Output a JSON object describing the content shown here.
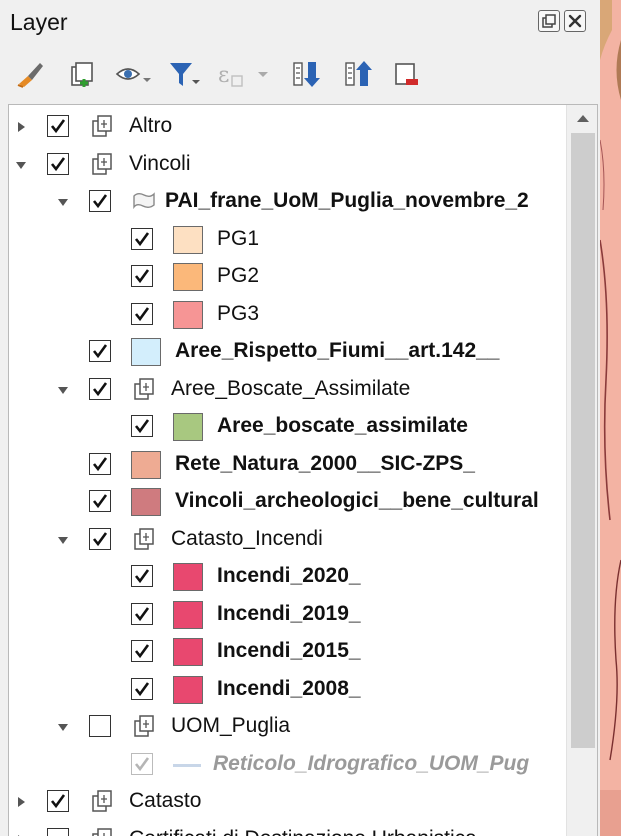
{
  "panel": {
    "title": "Layer"
  },
  "toolbar": {
    "icons": [
      "style-brush-icon",
      "add-group-icon",
      "visibility-eye-icon",
      "filter-icon",
      "expression-filter-icon",
      "expand-all-icon",
      "collapse-all-icon",
      "remove-layer-icon"
    ]
  },
  "tree": {
    "nodes": [
      {
        "label": "Altro",
        "level": 0,
        "expand": "collapsed",
        "checked": true,
        "icon": "group-icon",
        "bold": false
      },
      {
        "label": "Vincoli",
        "level": 0,
        "expand": "expanded",
        "checked": true,
        "icon": "group-icon",
        "bold": false
      },
      {
        "label": "PAI_frane_UoM_Puglia_novembre_2",
        "level": 1,
        "expand": "expanded",
        "checked": true,
        "icon": "polygon-layer-icon",
        "bold": true
      },
      {
        "label": "PG1",
        "level": 2,
        "expand": "none",
        "checked": true,
        "swatch": "#fde0c2",
        "bold": false
      },
      {
        "label": "PG2",
        "level": 2,
        "expand": "none",
        "checked": true,
        "swatch": "#fbb87a",
        "bold": false
      },
      {
        "label": "PG3",
        "level": 2,
        "expand": "none",
        "checked": true,
        "swatch": "#f69595",
        "bold": false
      },
      {
        "label": "Aree_Rispetto_Fiumi__art.142__",
        "level": 1,
        "expand": "none",
        "checked": true,
        "swatch": "#d3eefc",
        "bold": true
      },
      {
        "label": "Aree_Boscate_Assimilate",
        "level": 1,
        "expand": "expanded",
        "checked": true,
        "icon": "group-icon",
        "bold": false
      },
      {
        "label": "Aree_boscate_assimilate",
        "level": 2,
        "expand": "none",
        "checked": true,
        "swatch": "#a8c880",
        "bold": true
      },
      {
        "label": "Rete_Natura_2000__SIC-ZPS_",
        "level": 1,
        "expand": "none",
        "checked": true,
        "swatch": "#eeab93",
        "bold": true
      },
      {
        "label": "Vincoli_archeologici__bene_cultural",
        "level": 1,
        "expand": "none",
        "checked": true,
        "swatch": "#cf7b7f",
        "bold": true
      },
      {
        "label": "Catasto_Incendi",
        "level": 1,
        "expand": "expanded",
        "checked": true,
        "icon": "group-icon",
        "bold": false
      },
      {
        "label": "Incendi_2020_",
        "level": 2,
        "expand": "none",
        "checked": true,
        "swatch": "#e8486f",
        "bold": true
      },
      {
        "label": "Incendi_2019_",
        "level": 2,
        "expand": "none",
        "checked": true,
        "swatch": "#e8486f",
        "bold": true
      },
      {
        "label": "Incendi_2015_",
        "level": 2,
        "expand": "none",
        "checked": true,
        "swatch": "#e8486f",
        "bold": true
      },
      {
        "label": "Incendi_2008_",
        "level": 2,
        "expand": "none",
        "checked": true,
        "swatch": "#e8486f",
        "bold": true
      },
      {
        "label": "UOM_Puglia",
        "level": 1,
        "expand": "expanded",
        "checked": false,
        "icon": "group-icon",
        "bold": false
      },
      {
        "label": "Reticolo_Idrografico_UOM_Pug",
        "level": 2,
        "expand": "none",
        "checked": true,
        "disabled": true,
        "symbol": "line",
        "bold": true
      },
      {
        "label": "Catasto",
        "level": 0,
        "expand": "collapsed",
        "checked": true,
        "icon": "group-icon",
        "bold": false
      },
      {
        "label": "Certificati di Destinazione Urbanistica",
        "level": 0,
        "expand": "collapsed",
        "checked": false,
        "icon": "group-icon",
        "bold": false
      }
    ]
  },
  "colors": {
    "panel_bg": "#f0f0f0",
    "tree_bg": "#ffffff",
    "map_fill": "#f3b3a3"
  }
}
